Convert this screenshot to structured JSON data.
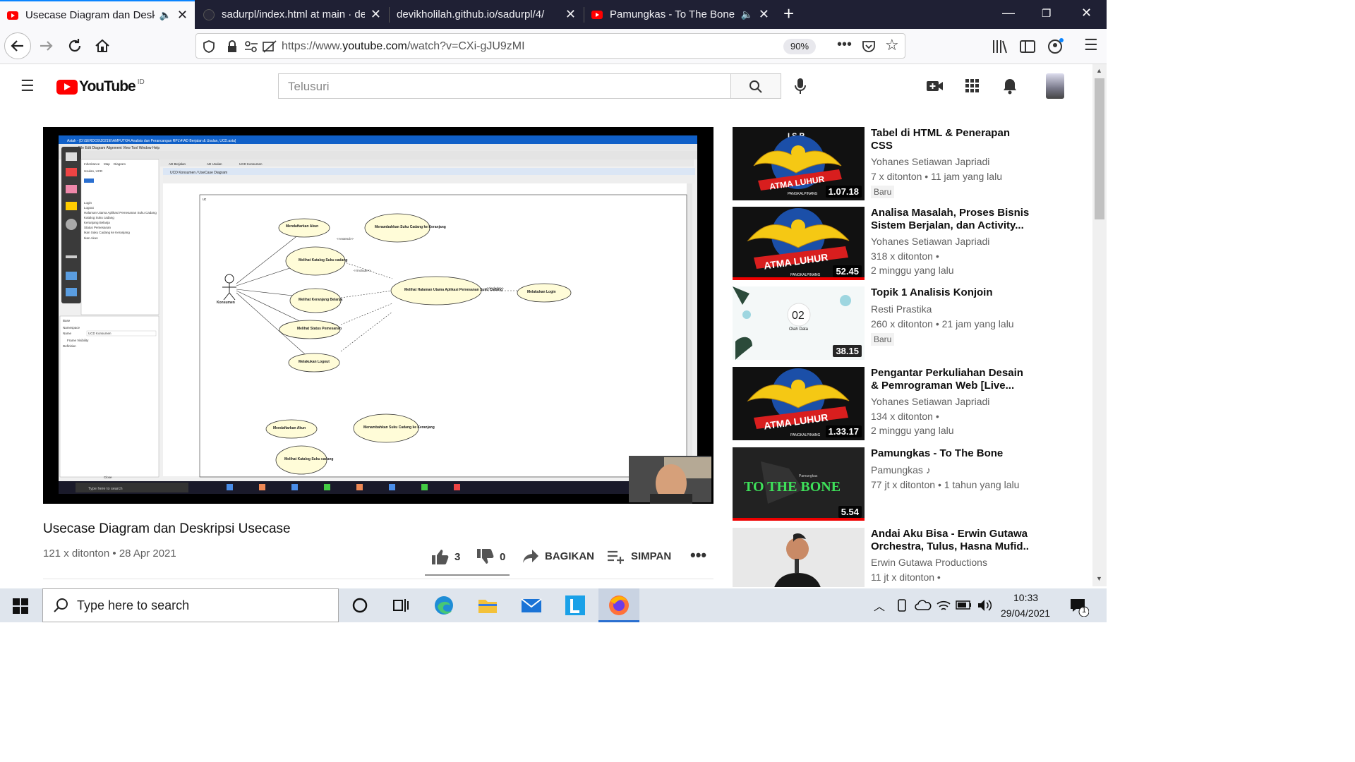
{
  "browser": {
    "tabs": [
      {
        "title": "Usecase Diagram dan Deskr",
        "active": true,
        "audio": true
      },
      {
        "title": "sadurpl/index.html at main · de",
        "active": false
      },
      {
        "title": "devikholilah.github.io/sadurpl/4/",
        "active": false
      },
      {
        "title": "Pamungkas - To The Bone -",
        "active": false,
        "audio": true
      }
    ],
    "new_tab": "+",
    "url_domain_pre": "https://www.",
    "url_domain": "youtube.com",
    "url_rest": "/watch?v=CXi-gJU9zMI",
    "zoom": "90%"
  },
  "youtube": {
    "logo_text": "YouTube",
    "region": "ID",
    "search_placeholder": "Telusuri"
  },
  "video": {
    "title": "Usecase Diagram dan Deskripsi Usecase",
    "meta": "121 x ditonton • 28 Apr 2021",
    "likes": "3",
    "dislikes": "0",
    "share_label": "BAGIKAN",
    "save_label": "SIMPAN",
    "screen": {
      "app_title": "Astah - [D:\\SERDOS\\2021\\E\\AMFUT\\04.Analisis dan Perancangan RPL\\4\\AD Berjalan & Usulan, UCD.asta]",
      "menu": "File  Edit  Diagram  Alignment  View  Tool  Window  Help",
      "tabs": [
        "AD Berjalan",
        "AD Usulan",
        "UCD Konsumen"
      ],
      "diagram_title": "UCD Konsumen / UseCase Diagram",
      "frame_label": "uc",
      "actor": "Konsumen",
      "usecases": [
        "Mendaftarkan Akun",
        "Melihat Katalog Suku cadang",
        "Melihat Keranjang Belanja",
        "Melihat Status Pemesanan",
        "Melakukan Logout",
        "Menambahkan Suku Cadang ke Keranjang",
        "Melihat Halaman Utama Aplikasi Pemesanan Suku Cadang",
        "Melakukan Login"
      ],
      "rel_extend": "<<extend>>",
      "rel_include": "<<include>>",
      "tree_items": [
        "Inheritance",
        "Map",
        "Diagram",
        "Usulan, UCD",
        "Login",
        "Logout",
        "Halaman Utama Aplikasi Pemesanan Suku Cadang",
        "Katalog Suku cadang",
        "Keranjang Belanja",
        "Status Pemesanan",
        "Ikan Suku Cadang ke Keranjang",
        "Ikan Akun"
      ],
      "props": {
        "section": "Base",
        "namespace_label": "Namespace",
        "name_label": "Name",
        "name_value": "UCD Konsumen",
        "frame_visibility": "Frame Visibility",
        "definition": "Definition",
        "close": "Close"
      },
      "win_search": "Type here to search"
    }
  },
  "recommendations": [
    {
      "title": "Tabel di HTML & Penerapan CSS",
      "channel": "Yohanes Setiawan Japriadi",
      "meta1": "7 x ditonton • 11 jam yang lalu",
      "meta2": "",
      "badge": "Baru",
      "duration": "1.07.18",
      "thumb": "atma"
    },
    {
      "title": "Analisa Masalah, Proses Bisnis Sistem Berjalan, dan Activity...",
      "channel": "Yohanes Setiawan Japriadi",
      "meta1": "318 x ditonton •",
      "meta2": "2 minggu yang lalu",
      "badge": "",
      "duration": "52.45",
      "thumb": "atma"
    },
    {
      "title": "Topik 1 Analisis Konjoin",
      "channel": "Resti Prastika",
      "meta1": "260 x ditonton • 21 jam yang lalu",
      "meta2": "",
      "badge": "Baru",
      "duration": "38.15",
      "thumb": "konjoin",
      "thumb_num": "02",
      "thumb_sub": "Olah Data"
    },
    {
      "title": "Pengantar Perkuliahan Desain & Pemrograman Web [Live...",
      "channel": "Yohanes Setiawan Japriadi",
      "meta1": "134 x ditonton •",
      "meta2": "2 minggu yang lalu",
      "badge": "",
      "duration": "1.33.17",
      "thumb": "atma"
    },
    {
      "title": "Pamungkas - To The Bone",
      "channel": "Pamungkas ♪",
      "meta1": "77 jt x ditonton • 1 tahun yang lalu",
      "meta2": "",
      "badge": "",
      "duration": "5.54",
      "thumb": "bone",
      "thumb_text": "TO THE BONE",
      "thumb_small": "Pamungkas"
    },
    {
      "title": "Andai Aku Bisa - Erwin Gutawa Orchestra, Tulus, Hasna Mufid...",
      "channel": "Erwin Gutawa Productions",
      "meta1": "11 jt x ditonton •",
      "meta2": "",
      "badge": "",
      "duration": "",
      "thumb": "singer"
    }
  ],
  "atma": {
    "top": "I S B",
    "banner": "ATMA LUHUR",
    "sub": "PANGKALPINANG"
  },
  "taskbar": {
    "search_placeholder": "Type here to search",
    "time": "10:33",
    "date": "29/04/2021",
    "notif_count": "1"
  },
  "colors": {
    "youtube_red": "#ff0000",
    "tab_bar": "#1f2034",
    "firefox_accent": "#0a84ff"
  }
}
